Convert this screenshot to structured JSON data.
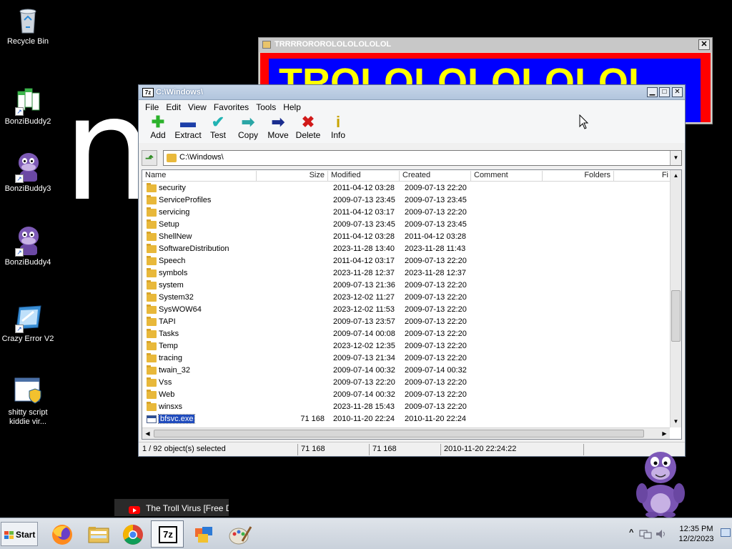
{
  "desktop": {
    "icons": [
      {
        "label": "Recycle Bin"
      },
      {
        "label": "BonziBuddy2"
      },
      {
        "label": "BonziBuddy3"
      },
      {
        "label": "BonziBuddy4"
      },
      {
        "label": "Crazy Error V2"
      },
      {
        "label": "shitty script kiddie vir..."
      }
    ],
    "big_letter": "n"
  },
  "troll_window": {
    "title": "TRRRROROROLOLOLOLOLOL",
    "banner_text": "TROLOLOLOLOLOL",
    "close": "✕"
  },
  "sevenzip": {
    "title": "C:\\Windows\\",
    "icon_text": "7z",
    "menu": [
      "File",
      "Edit",
      "View",
      "Favorites",
      "Tools",
      "Help"
    ],
    "toolbar": [
      {
        "label": "Add",
        "icon": "plus-icon",
        "color": "#2bb22b",
        "glyph": "✚"
      },
      {
        "label": "Extract",
        "icon": "minus-icon",
        "color": "#1c3fa8",
        "glyph": "▬"
      },
      {
        "label": "Test",
        "icon": "check-icon",
        "color": "#21b3b3",
        "glyph": "✔"
      },
      {
        "label": "Copy",
        "icon": "copy-arrow-icon",
        "color": "#2aa6a6",
        "glyph": "➡"
      },
      {
        "label": "Move",
        "icon": "move-arrow-icon",
        "color": "#1a2d8f",
        "glyph": "➡"
      },
      {
        "label": "Delete",
        "icon": "delete-x-icon",
        "color": "#d11a1a",
        "glyph": "✖"
      },
      {
        "label": "Info",
        "icon": "info-icon",
        "color": "#c8a400",
        "glyph": "i"
      }
    ],
    "path": "C:\\Windows\\",
    "columns": [
      "Name",
      "Size",
      "Modified",
      "Created",
      "Comment",
      "Folders",
      "Fi"
    ],
    "rows": [
      {
        "name": "security",
        "size": "",
        "modified": "2011-04-12 03:28",
        "created": "2009-07-13 22:20",
        "type": "folder"
      },
      {
        "name": "ServiceProfiles",
        "size": "",
        "modified": "2009-07-13 23:45",
        "created": "2009-07-13 23:45",
        "type": "folder"
      },
      {
        "name": "servicing",
        "size": "",
        "modified": "2011-04-12 03:17",
        "created": "2009-07-13 22:20",
        "type": "folder"
      },
      {
        "name": "Setup",
        "size": "",
        "modified": "2009-07-13 23:45",
        "created": "2009-07-13 23:45",
        "type": "folder"
      },
      {
        "name": "ShellNew",
        "size": "",
        "modified": "2011-04-12 03:28",
        "created": "2011-04-12 03:28",
        "type": "folder"
      },
      {
        "name": "SoftwareDistribution",
        "size": "",
        "modified": "2023-11-28 13:40",
        "created": "2023-11-28 11:43",
        "type": "folder"
      },
      {
        "name": "Speech",
        "size": "",
        "modified": "2011-04-12 03:17",
        "created": "2009-07-13 22:20",
        "type": "folder"
      },
      {
        "name": "symbols",
        "size": "",
        "modified": "2023-11-28 12:37",
        "created": "2023-11-28 12:37",
        "type": "folder"
      },
      {
        "name": "system",
        "size": "",
        "modified": "2009-07-13 21:36",
        "created": "2009-07-13 22:20",
        "type": "folder"
      },
      {
        "name": "System32",
        "size": "",
        "modified": "2023-12-02 11:27",
        "created": "2009-07-13 22:20",
        "type": "folder"
      },
      {
        "name": "SysWOW64",
        "size": "",
        "modified": "2023-12-02 11:53",
        "created": "2009-07-13 22:20",
        "type": "folder"
      },
      {
        "name": "TAPI",
        "size": "",
        "modified": "2009-07-13 23:57",
        "created": "2009-07-13 22:20",
        "type": "folder"
      },
      {
        "name": "Tasks",
        "size": "",
        "modified": "2009-07-14 00:08",
        "created": "2009-07-13 22:20",
        "type": "folder"
      },
      {
        "name": "Temp",
        "size": "",
        "modified": "2023-12-02 12:35",
        "created": "2009-07-13 22:20",
        "type": "folder"
      },
      {
        "name": "tracing",
        "size": "",
        "modified": "2009-07-13 21:34",
        "created": "2009-07-13 22:20",
        "type": "folder"
      },
      {
        "name": "twain_32",
        "size": "",
        "modified": "2009-07-14 00:32",
        "created": "2009-07-14 00:32",
        "type": "folder"
      },
      {
        "name": "Vss",
        "size": "",
        "modified": "2009-07-13 22:20",
        "created": "2009-07-13 22:20",
        "type": "folder"
      },
      {
        "name": "Web",
        "size": "",
        "modified": "2009-07-14 00:32",
        "created": "2009-07-13 22:20",
        "type": "folder"
      },
      {
        "name": "winsxs",
        "size": "",
        "modified": "2023-11-28 15:43",
        "created": "2009-07-13 22:20",
        "type": "folder"
      },
      {
        "name": "bfsvc.exe",
        "size": "71 168",
        "modified": "2010-11-20 22:24",
        "created": "2010-11-20 22:24",
        "type": "exe",
        "selected": true
      }
    ],
    "status": {
      "selection": "1 / 92 object(s) selected",
      "size": "71 168",
      "packed": "71 168",
      "date": "2010-11-20 22:24:22"
    }
  },
  "notification": {
    "text": "The Troll Virus [Free D"
  },
  "taskbar": {
    "start_label": "Start",
    "apps": [
      "firefox-icon",
      "file-explorer-icon",
      "chrome-icon",
      "7zip-icon",
      "windows-panel-icon",
      "paint-icon"
    ],
    "active_app_text": "7z",
    "tray_expand": "^",
    "time": "12:35 PM",
    "date": "12/2/2023"
  }
}
